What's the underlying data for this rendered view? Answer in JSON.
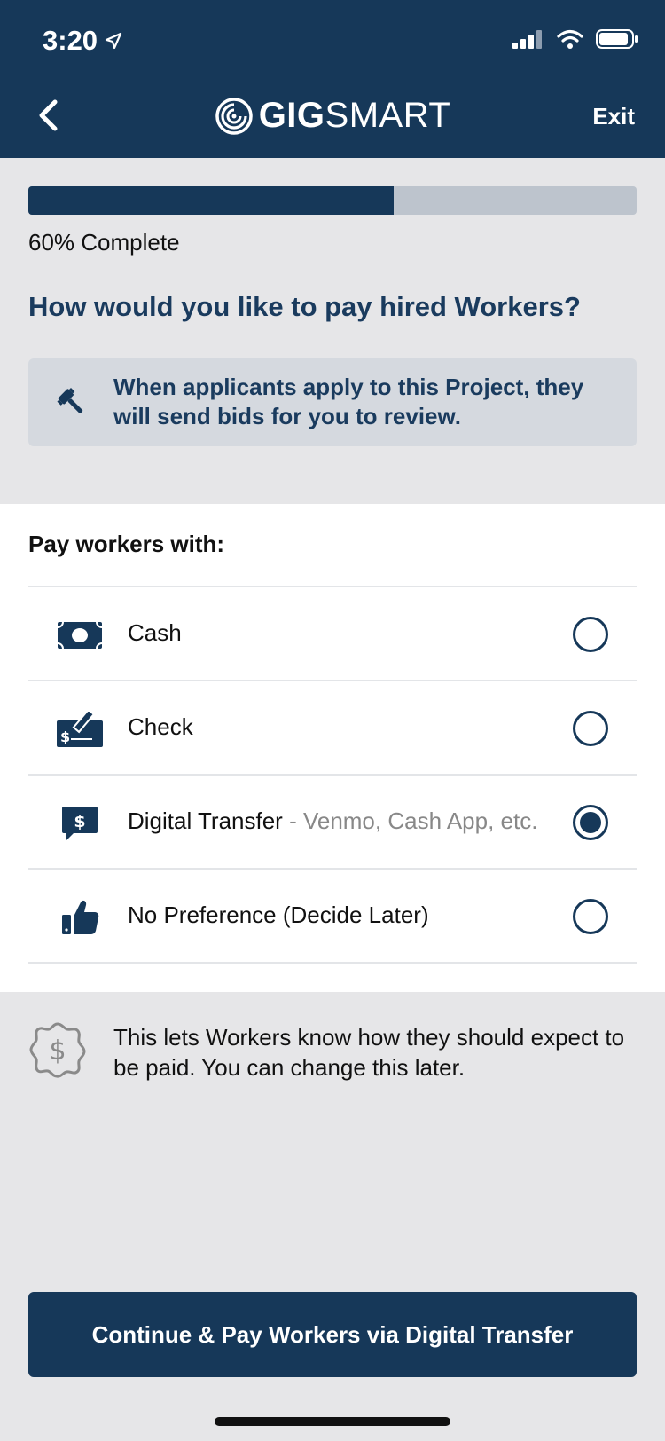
{
  "status_bar": {
    "time": "3:20"
  },
  "header": {
    "logo_bold": "GIG",
    "logo_light": "SMART",
    "exit_label": "Exit"
  },
  "progress": {
    "fraction": 0.6,
    "label": "60% Complete"
  },
  "question": "How would you like to pay hired Workers?",
  "notice": {
    "icon": "gavel-icon",
    "text": "When applicants apply to this Project, they will send bids for you to review."
  },
  "payment": {
    "title": "Pay workers with:",
    "options": [
      {
        "label": "Cash",
        "sub": "",
        "icon": "cash-icon",
        "selected": false
      },
      {
        "label": "Check",
        "sub": "",
        "icon": "check-icon",
        "selected": false
      },
      {
        "label": "Digital Transfer",
        "sub": " - Venmo, Cash App, etc.",
        "icon": "digital-transfer-icon",
        "selected": true
      },
      {
        "label": "No Preference (Decide Later)",
        "sub": "",
        "icon": "thumbs-up-icon",
        "selected": false
      }
    ]
  },
  "info": {
    "icon": "dollar-badge-icon",
    "text": "This lets Workers know how they should expect to be paid. You can change this later."
  },
  "cta": {
    "label": "Continue & Pay Workers via Digital Transfer"
  },
  "colors": {
    "brand": "#163859",
    "background": "#e6e6e8",
    "track": "#bdc4cd"
  }
}
